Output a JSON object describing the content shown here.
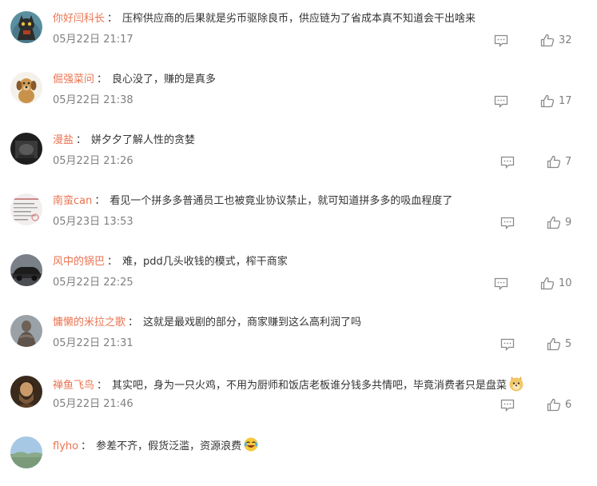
{
  "comments": [
    {
      "username": "你好闫科长",
      "colon": "：",
      "text": "压榨供应商的后果就是劣币驱除良币，供应链为了省成本真不知道会干出啥来",
      "time": "05月22日 21:17",
      "likes": "32",
      "avatar_icon": "cat-avatar-icon"
    },
    {
      "username": "倔强菜问",
      "colon": "：",
      "text": "良心没了，赚的是真多",
      "time": "05月22日 21:38",
      "likes": "17",
      "avatar_icon": "dog-avatar-icon"
    },
    {
      "username": "漫盐",
      "colon": "：",
      "text": "姘夕夕了解人性的贪婪",
      "time": "05月22日 21:26",
      "likes": "7",
      "avatar_icon": "dark-photo-avatar-icon"
    },
    {
      "username": "南蛮can",
      "colon": "：",
      "text": "看见一个拼多多普通员工也被竟业协议禁止，就可知道拼多多的吸血程度了",
      "time": "05月23日 13:53",
      "likes": "9",
      "avatar_icon": "document-avatar-icon"
    },
    {
      "username": "风中的锅巴",
      "colon": "：",
      "text": "难，pdd几头收钱的模式，榨干商家",
      "time": "05月22日 22:25",
      "likes": "10",
      "avatar_icon": "car-avatar-icon"
    },
    {
      "username": "慵懒的米拉之歌",
      "colon": "：",
      "text": "这就是最戏剧的部分，商家赚到这么高利润了吗",
      "time": "05月22日 21:31",
      "likes": "5",
      "avatar_icon": "statue-avatar-icon"
    },
    {
      "username": "禅鱼飞鸟",
      "colon": "：",
      "text": "其实吧，身为一只火鸡，不用为厨师和饭店老板谁分钱多共情吧，毕竟消费者只是盘菜",
      "time": "05月22日 21:46",
      "likes": "6",
      "avatar_icon": "portrait-avatar-icon",
      "emoji": "doge-emoji-icon"
    },
    {
      "username": "flyho",
      "colon": "：",
      "text": "参差不齐，假货泛滥，资源浪费",
      "time": "",
      "likes": "",
      "avatar_icon": "landscape-avatar-icon",
      "emoji": "laugh-tears-emoji-icon"
    }
  ]
}
